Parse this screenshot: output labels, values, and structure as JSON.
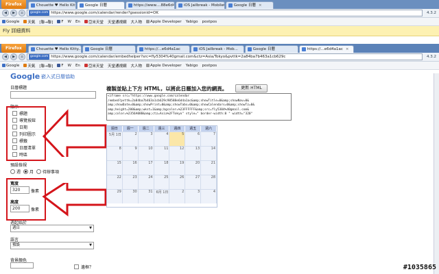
{
  "browser1": {
    "firefox_label": "Firefox",
    "tabs": [
      {
        "label": "Chouette ♥ Hello Kitty..."
      },
      {
        "label": "Google 日曆"
      },
      {
        "label": "https://www....88e6d4a1ac"
      },
      {
        "label": "iOS Jailbreak - Mobile01"
      },
      {
        "label": "Google 日曆"
      }
    ],
    "url": "https://www.google.com/calendar/render?gsessionid=OK",
    "version": "4.3.2"
  },
  "bookmarks1": {
    "items": [
      "Google",
      "天氣",
      "[聯→聯]",
      "F",
      "W",
      "En",
      "亞米天堂",
      "天堂通視網",
      "大人物",
      "Apple Developer",
      "Yabigo",
      "postpos"
    ]
  },
  "yellowbar": {
    "text": "Fly 詳細資料"
  },
  "browser2": {
    "firefox_label": "Firefox",
    "tabs": [
      {
        "label": "Chouette ♥ Hello Kitty..."
      },
      {
        "label": "Google 日曆"
      },
      {
        "label": "https://...e6d4a1ac"
      },
      {
        "label": "iOS Jailbreak - Mob..."
      },
      {
        "label": "Google 日曆"
      },
      {
        "label": "https://...e6d4a1ac"
      }
    ],
    "url": "https://www.google.com/calendar/embedhelper?src=fly5304%40gmail.com&ctz=Asia/Tokyo&pvttk=2a84ba7b463a1cb629c",
    "version": "4.3.2"
  },
  "bookmarks2": {
    "items": [
      "Google",
      "天氣",
      "[聯→聯]",
      "F",
      "W",
      "En",
      "亞米天堂",
      "天堂通視網",
      "大人物",
      "Apple Developer",
      "Yabigo",
      "postpos"
    ]
  },
  "page": {
    "logo_text": "Google",
    "logo_sub": "嵌入式日曆協助",
    "calendar_title_label": "日曆標題",
    "show_label": "顯示",
    "checkboxes": [
      "標題",
      "導覽按鈕",
      "日期",
      "列印圖示",
      "標籤",
      "日曆清單",
      "時區"
    ],
    "default_view_label": "預設檢視",
    "view_options": [
      "週",
      "月",
      "待辦事項"
    ],
    "width_label": "寬度",
    "width_value": "320",
    "width_unit": "像素",
    "height_label": "高度",
    "height_value": "200",
    "height_unit": "像素",
    "week_start_label": "週起始於",
    "week_start_value": "週日",
    "language_label": "語言",
    "language_value": "預設",
    "bg_color_label": "背景顏色",
    "border_label": "邊框？",
    "instruction": "複製並貼上下方 HTML，以將此日曆加入您的網頁。",
    "update_button": "更新 HTML",
    "embed_code": "<iframe src=\"https://www.google.com/calendar\n/embed?pvttk=2a84ba7b463a1cb629c98588e6d4a1ac&amp;showTitle=0&amp;showNav=0&\namp;showDate=0&amp;showPrint=0&amp;showTabs=0&amp;showCalendars=0&amp;showTz=0&\namp;height=200&amp;wkst=1&amp;bgcolor=%23FFFFFF&amp;src=fly5304%40gmail.com&\namp;color=%2356A08B&amp;ctz=Asia%2FTokyo\" style=\" border-width:0 \" width=\"320\"",
    "calendar_days_header": [
      "週日",
      "週一",
      "週二",
      "週三",
      "週四",
      "週五",
      "週六"
    ],
    "calendar_rows": [
      [
        "5月 1日",
        "2",
        "3",
        "4",
        "5",
        "6",
        "7"
      ],
      [
        "8",
        "9",
        "10",
        "11",
        "12",
        "13",
        "14"
      ],
      [
        "15",
        "16",
        "17",
        "18",
        "19",
        "20",
        "21"
      ],
      [
        "22",
        "23",
        "24",
        "25",
        "26",
        "27",
        "28"
      ],
      [
        "29",
        "30",
        "31",
        "6月 1日",
        "2",
        "3",
        "4"
      ]
    ]
  },
  "watermark": "#1035865",
  "colors": {
    "accent_red": "#d4141a",
    "firefox_orange": "#e07b10",
    "calendar_header": "#c3d2ee",
    "today": "#fbe7a8"
  }
}
